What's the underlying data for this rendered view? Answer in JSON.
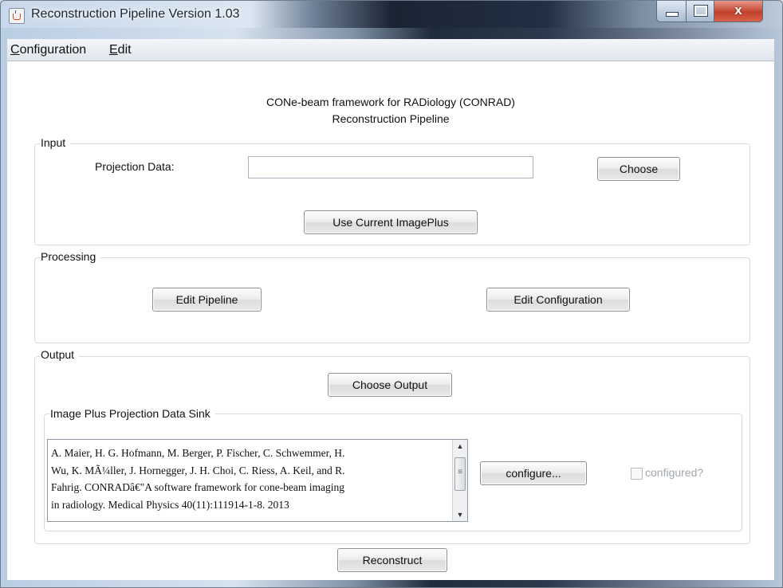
{
  "window": {
    "title": "Reconstruction Pipeline Version 1.03",
    "close_symbol": "x"
  },
  "icons": {
    "app": "java-cup-icon",
    "minimize": "minimize-icon",
    "maximize": "maximize-icon",
    "close": "close-icon",
    "scroll_up": "scroll-up-arrow-icon",
    "scroll_down": "scroll-down-arrow-icon"
  },
  "menu": {
    "items": [
      {
        "label": "Configuration",
        "mnemonic": "C"
      },
      {
        "label": "Edit",
        "mnemonic": "E"
      }
    ]
  },
  "header": {
    "line1": "CONe-beam framework for RADiology (CONRAD)",
    "line2": "Reconstruction Pipeline"
  },
  "input_group": {
    "title": "Input",
    "projection_label": "Projection Data:",
    "projection_value": "",
    "choose_label": "Choose",
    "use_current_label": "Use Current ImagePlus"
  },
  "processing_group": {
    "title": "Processing",
    "edit_pipeline_label": "Edit Pipeline",
    "edit_configuration_label": "Edit Configuration"
  },
  "output_group": {
    "title": "Output",
    "choose_output_label": "Choose Output",
    "sink": {
      "title": "Image Plus Projection Data Sink",
      "citation_lines": [
        "A. Maier, H. G. Hofmann, M. Berger, P. Fischer, C. Schwemmer, H.",
        "Wu, K. MÃ¼ller, J. Hornegger, J. H. Choi, C. Riess, A. Keil, and R.",
        "Fahrig. CONRADâ€\"A software framework for cone-beam imaging",
        "in radiology. Medical Physics 40(11):111914-1-8. 2013"
      ],
      "configure_label": "configure...",
      "configured_label": "configured?",
      "configured": false
    }
  },
  "reconstruct_label": "Reconstruct",
  "colors": {
    "content_bg": "#ffffff",
    "group_border": "#d5dbe2",
    "disabled_text": "#a0a6ad",
    "close_button": "#c2412c"
  }
}
